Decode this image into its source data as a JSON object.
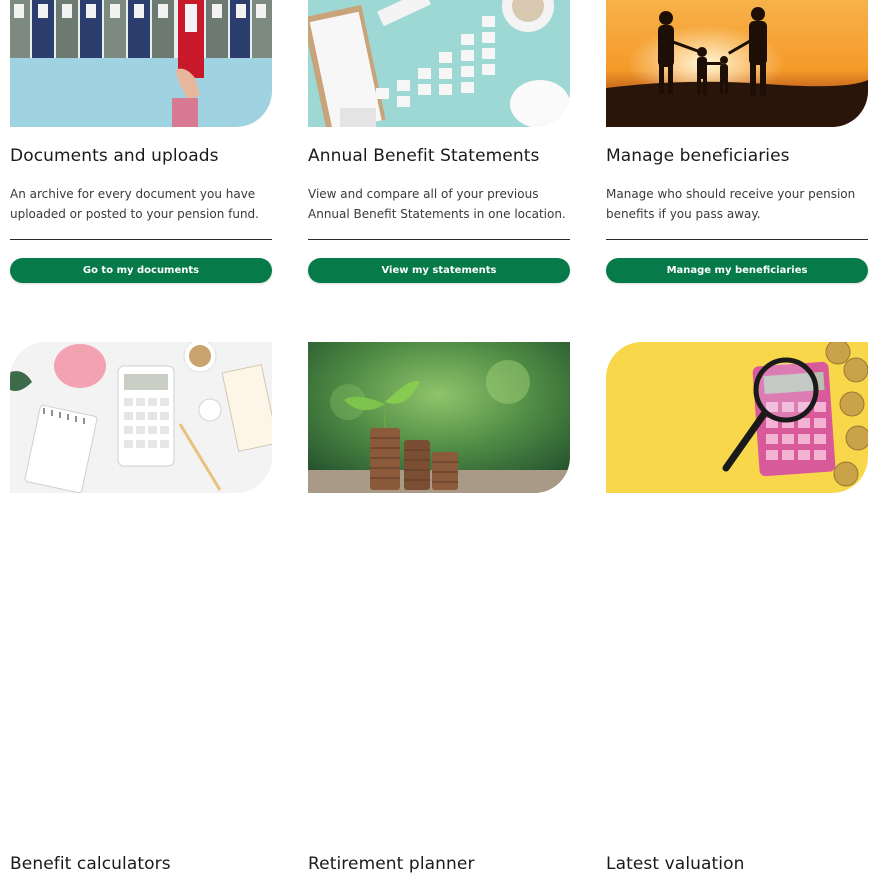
{
  "cards": [
    {
      "title": "Documents and uploads",
      "description": "An archive for every document you have uploaded or posted to your pension fund.",
      "button": "Go to my documents",
      "image": "binders-photo"
    },
    {
      "title": "Annual Benefit Statements",
      "description": "View and compare all of your previous Annual Benefit Statements in one location.",
      "button": "View my statements",
      "image": "bar-chart-blocks-piggy-bank-photo"
    },
    {
      "title": "Manage beneficiaries",
      "description": "Manage who should receive your pension benefits if you pass away.",
      "button": "Manage my beneficiaries",
      "image": "family-sunset-photo"
    },
    {
      "title": "Benefit calculators",
      "image": "calculator-desk-photo"
    },
    {
      "title": "Retirement planner",
      "image": "coins-plant-photo"
    },
    {
      "title": "Latest valuation",
      "image": "magnifier-calculator-photo"
    }
  ],
  "colors": {
    "button": "#067a49",
    "button_text": "#ffffff",
    "background": "#ffffff"
  }
}
